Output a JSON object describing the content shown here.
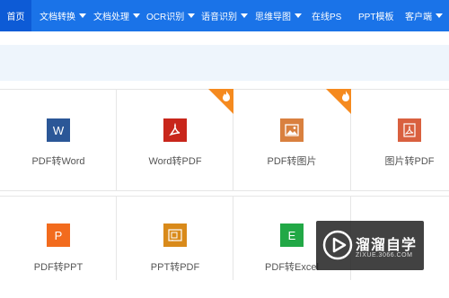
{
  "nav": {
    "items": [
      {
        "label": "首页",
        "dropdown": false,
        "active": true
      },
      {
        "label": "文档转换",
        "dropdown": true
      },
      {
        "label": "文档处理",
        "dropdown": true
      },
      {
        "label": "OCR识别",
        "dropdown": true
      },
      {
        "label": "语音识别",
        "dropdown": true
      },
      {
        "label": "思维导图",
        "dropdown": true
      },
      {
        "label": "在线PS",
        "dropdown": false
      },
      {
        "label": "PPT模板",
        "dropdown": false
      },
      {
        "label": "客户端",
        "dropdown": true
      }
    ]
  },
  "tools": [
    {
      "label": "PDF转Word",
      "icon": "word-icon",
      "icon_text": "W",
      "color": "#2b5797",
      "hot": false
    },
    {
      "label": "Word转PDF",
      "icon": "pdf-icon",
      "icon_text": "",
      "color": "#c8261b",
      "hot": true
    },
    {
      "label": "PDF转图片",
      "icon": "image-icon",
      "icon_text": "",
      "color": "#d9803f",
      "hot": false
    },
    {
      "label": "图片转PDF",
      "icon": "pdf-icon",
      "icon_text": "",
      "color": "#d9603f",
      "hot": true
    },
    {
      "label": "PDF转PPT",
      "icon": "ppt-icon",
      "icon_text": "P",
      "color": "#f26b1d",
      "hot": false
    },
    {
      "label": "PPT转PDF",
      "icon": "ppt-pdf-icon",
      "icon_text": "",
      "color": "#d98a1a",
      "hot": false
    },
    {
      "label": "PDF转Excel",
      "icon": "excel-icon",
      "icon_text": "E",
      "color": "#22a846",
      "hot": false
    }
  ],
  "watermark": {
    "title": "溜溜自学",
    "subtitle": "ZIXUE.3066.COM"
  }
}
